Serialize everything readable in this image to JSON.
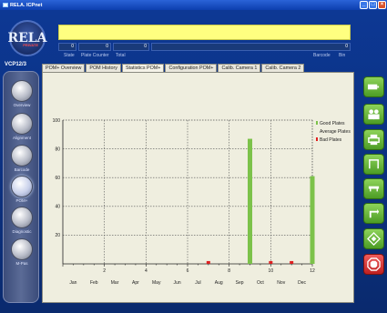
{
  "window": {
    "title": "RELA. ICPnet"
  },
  "header": {
    "logo_text": "RELA",
    "logo_sub": "PRIVATE",
    "machine_id": "VCP12/3",
    "counters": [
      "0",
      "0",
      "0",
      "0"
    ],
    "counter_labels": {
      "state": "State",
      "plate_counter": "Plate Counter",
      "total": "Total",
      "barcode": "Barcode",
      "bin": "Bin"
    }
  },
  "tabs": [
    {
      "label": "POM+ Overview",
      "active": false
    },
    {
      "label": "POM History",
      "active": false
    },
    {
      "label": "Statistics POM+",
      "active": true
    },
    {
      "label": "Configuration POM+",
      "active": false
    },
    {
      "label": "Calib. Camera 1",
      "active": false
    },
    {
      "label": "Calib. Camera 2",
      "active": false
    }
  ],
  "nav": [
    {
      "label": "Overview"
    },
    {
      "label": "Alignment"
    },
    {
      "label": "Barcode"
    },
    {
      "label": "POM+",
      "active": true
    },
    {
      "label": "Diagnostic"
    },
    {
      "label": "M-Pas"
    }
  ],
  "toolbar": {
    "buttons": [
      {
        "icon": "battery-icon"
      },
      {
        "icon": "users-icon"
      },
      {
        "icon": "printer-icon"
      },
      {
        "icon": "frame-icon"
      },
      {
        "icon": "tray-icon"
      },
      {
        "icon": "cycle-icon"
      },
      {
        "icon": "diamond-icon"
      },
      {
        "icon": "stop-icon"
      }
    ]
  },
  "colors": {
    "good": "#7cc24a",
    "bad": "#e02020",
    "yellow": "#ffff80"
  },
  "chart_data": {
    "type": "bar",
    "x_ticks": [
      2,
      4,
      6,
      8,
      10,
      12
    ],
    "months": [
      "Jan",
      "Feb",
      "Mar",
      "Apr",
      "May",
      "Jun",
      "Jul",
      "Aug",
      "Sep",
      "Oct",
      "Nov",
      "Dec"
    ],
    "ylim": [
      0,
      100
    ],
    "y_ticks": [
      20,
      40,
      60,
      80,
      100
    ],
    "xlim": [
      0,
      12
    ],
    "grid": true,
    "legend_position": "top-right",
    "series": [
      {
        "name": "Good Plates",
        "points": [
          {
            "x": 9,
            "y": 87
          },
          {
            "x": 12,
            "y": 61
          }
        ]
      },
      {
        "name": "Average Plates",
        "points": []
      },
      {
        "name": "Bad Plates",
        "points": [
          {
            "x": 7,
            "y": 1
          },
          {
            "x": 10,
            "y": 1
          },
          {
            "x": 11,
            "y": 1
          }
        ]
      }
    ]
  }
}
